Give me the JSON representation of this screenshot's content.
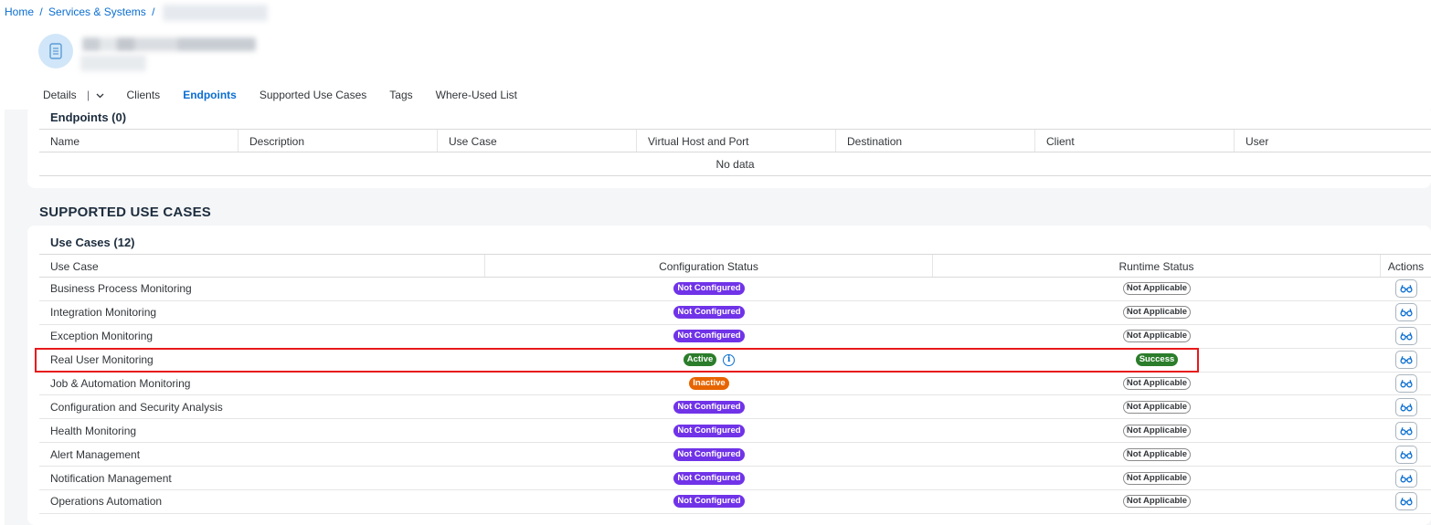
{
  "breadcrumb": {
    "home": "Home",
    "sep": "/",
    "services": "Services & Systems",
    "sep2": "/"
  },
  "tabs": [
    {
      "label": "Details"
    },
    {
      "label": "Clients"
    },
    {
      "label": "Endpoints"
    },
    {
      "label": "Supported Use Cases"
    },
    {
      "label": "Tags"
    },
    {
      "label": "Where-Used List"
    }
  ],
  "tab_split_sep": "|",
  "endpoints": {
    "title": "Endpoints (0)",
    "columns": [
      "Name",
      "Description",
      "Use Case",
      "Virtual Host and Port",
      "Destination",
      "Client",
      "User"
    ],
    "empty_text": "No data"
  },
  "supported_use_cases": {
    "section_title": "SUPPORTED USE CASES",
    "table_title": "Use Cases (12)",
    "columns": [
      "Use Case",
      "Configuration Status",
      "Runtime Status",
      "Actions"
    ],
    "rows": [
      {
        "name": "Business Process Monitoring",
        "config": "Not Configured",
        "runtime": "Not Applicable"
      },
      {
        "name": "Integration Monitoring",
        "config": "Not Configured",
        "runtime": "Not Applicable"
      },
      {
        "name": "Exception Monitoring",
        "config": "Not Configured",
        "runtime": "Not Applicable"
      },
      {
        "name": "Real User Monitoring",
        "config": "Active",
        "runtime": "Success"
      },
      {
        "name": "Job & Automation Monitoring",
        "config": "Inactive",
        "runtime": "Not Applicable"
      },
      {
        "name": "Configuration and Security Analysis",
        "config": "Not Configured",
        "runtime": "Not Applicable"
      },
      {
        "name": "Health Monitoring",
        "config": "Not Configured",
        "runtime": "Not Applicable"
      },
      {
        "name": "Alert Management",
        "config": "Not Configured",
        "runtime": "Not Applicable"
      },
      {
        "name": "Notification Management",
        "config": "Not Configured",
        "runtime": "Not Applicable"
      },
      {
        "name": "Operations Automation",
        "config": "Not Configured",
        "runtime": "Not Applicable"
      }
    ]
  },
  "info_glyph": "i",
  "colors": {
    "accent": "#0a6ed1",
    "not_configured": "#7033e8",
    "active": "#2b7d2b",
    "inactive": "#e76500",
    "highlight": "#e8191b"
  },
  "icons": {
    "object": "document-icon",
    "action": "glasses-icon",
    "info": "info-icon"
  }
}
